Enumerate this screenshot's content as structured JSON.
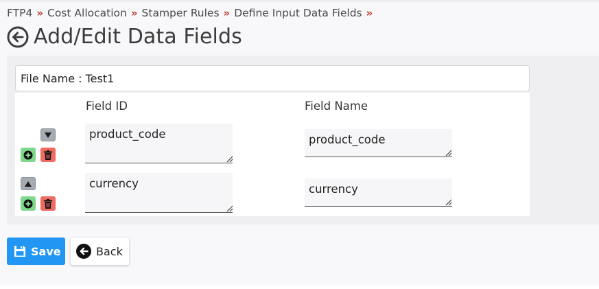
{
  "breadcrumb": {
    "items": [
      "FTP4",
      "Cost Allocation",
      "Stamper Rules",
      "Define Input Data Fields"
    ],
    "separator": "»"
  },
  "page": {
    "title": "Add/Edit Data Fields"
  },
  "file": {
    "label": "File Name : Test1"
  },
  "columns": {
    "field_id": "Field ID",
    "field_name": "Field Name"
  },
  "rows": [
    {
      "field_id": "product_code",
      "field_name": "product_code",
      "move": "down"
    },
    {
      "field_id": "currency",
      "field_name": "currency",
      "move": "up"
    }
  ],
  "icons": {
    "move_down": "triangle-down-icon",
    "move_up": "triangle-up-icon",
    "add": "plus-circle-icon",
    "delete": "trash-icon",
    "save": "floppy-disk-icon",
    "back": "arrow-left-circle-icon"
  },
  "actions": {
    "save": "Save",
    "back": "Back"
  },
  "colors": {
    "accent_red": "#c0392b",
    "save_blue": "#2196f3",
    "add_green": "#7fd88d",
    "delete_red": "#ee6b62",
    "move_gray": "#a4abb2"
  }
}
